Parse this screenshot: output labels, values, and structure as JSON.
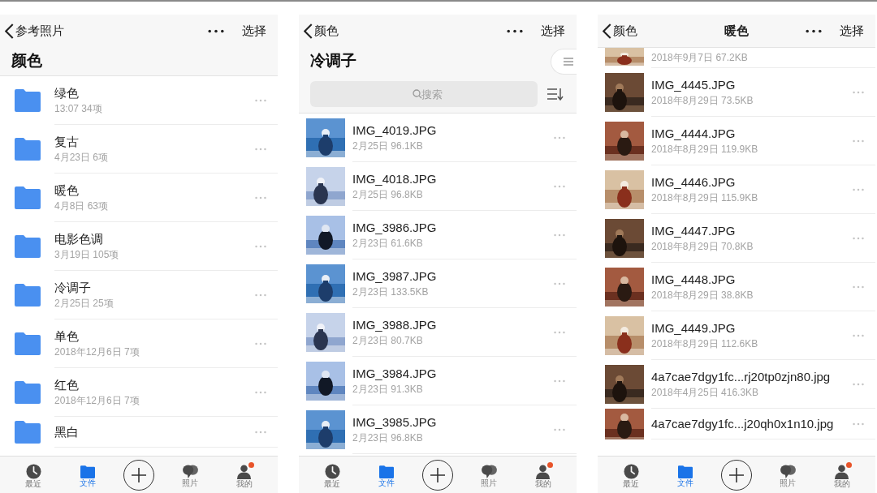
{
  "screens": [
    {
      "nav": {
        "back": "参考照片",
        "action": "选择"
      },
      "heading": "颜色",
      "items": [
        {
          "kind": "folder",
          "name": "绿色",
          "subtitle": "13:07  34项"
        },
        {
          "kind": "folder",
          "name": "复古",
          "subtitle": "4月23日  6项"
        },
        {
          "kind": "folder",
          "name": "暖色",
          "subtitle": "4月8日  63项"
        },
        {
          "kind": "folder",
          "name": "电影色调",
          "subtitle": "3月19日  105项"
        },
        {
          "kind": "folder",
          "name": "冷调子",
          "subtitle": "2月25日  25项"
        },
        {
          "kind": "folder",
          "name": "单色",
          "subtitle": "2018年12月6日  7项"
        },
        {
          "kind": "folder",
          "name": "红色",
          "subtitle": "2018年12月6日  7项"
        },
        {
          "kind": "folder",
          "name": "黑白"
        }
      ],
      "tabs": [
        {
          "kind": "clock",
          "label": "最近",
          "selected": false
        },
        {
          "kind": "folder",
          "label": "文件",
          "selected": true
        },
        {
          "kind": "add"
        },
        {
          "kind": "photos",
          "label": "照片",
          "selected": false
        },
        {
          "kind": "person",
          "label": "我的",
          "selected": false,
          "badge": true
        }
      ]
    },
    {
      "nav": {
        "back": "颜色",
        "action": "选择"
      },
      "heading": "冷调子",
      "view_toggle": true,
      "search": {
        "placeholder": "搜索"
      },
      "items": [
        {
          "name": "IMG_4019.JPG",
          "subtitle": "2月25日 96.1KB"
        },
        {
          "name": "IMG_4018.JPG",
          "subtitle": "2月25日 96.8KB"
        },
        {
          "name": "IMG_3986.JPG",
          "subtitle": "2月23日 61.6KB"
        },
        {
          "name": "IMG_3987.JPG",
          "subtitle": "2月23日 133.5KB"
        },
        {
          "name": "IMG_3988.JPG",
          "subtitle": "2月23日 80.7KB"
        },
        {
          "name": "IMG_3984.JPG",
          "subtitle": "2月23日 91.3KB"
        },
        {
          "name": "IMG_3985.JPG",
          "subtitle": "2月23日 96.8KB"
        }
      ],
      "tabs": [
        {
          "kind": "clock",
          "label": "最近",
          "selected": false
        },
        {
          "kind": "folder",
          "label": "文件",
          "selected": true
        },
        {
          "kind": "add"
        },
        {
          "kind": "photos",
          "label": "照片",
          "selected": false
        },
        {
          "kind": "person",
          "label": "我的",
          "selected": false,
          "badge": true
        }
      ]
    },
    {
      "nav": {
        "back": "颜色",
        "title": "暖色",
        "action": "选择"
      },
      "items": [
        {
          "subtitle": "2018年9月7日 67.2KB"
        },
        {
          "name": "IMG_4445.JPG",
          "subtitle": "2018年8月29日 73.5KB"
        },
        {
          "name": "IMG_4444.JPG",
          "subtitle": "2018年8月29日 119.9KB"
        },
        {
          "name": "IMG_4446.JPG",
          "subtitle": "2018年8月29日 115.9KB"
        },
        {
          "name": "IMG_4447.JPG",
          "subtitle": "2018年8月29日 70.8KB"
        },
        {
          "name": "IMG_4448.JPG",
          "subtitle": "2018年8月29日 38.8KB"
        },
        {
          "name": "IMG_4449.JPG",
          "subtitle": "2018年8月29日 112.6KB"
        },
        {
          "name": "4a7cae7dgy1fc...rj20tp0zjn80.jpg",
          "subtitle": "2018年4月25日 416.3KB"
        },
        {
          "name": "4a7cae7dgy1fc...j20qh0x1n10.jpg"
        }
      ],
      "tabs": [
        {
          "kind": "clock",
          "label": "最近",
          "selected": false
        },
        {
          "kind": "folder",
          "label": "文件",
          "selected": true
        },
        {
          "kind": "add"
        },
        {
          "kind": "photos",
          "label": "照片",
          "selected": false
        },
        {
          "kind": "person",
          "label": "我的",
          "selected": false,
          "badge": true
        }
      ]
    }
  ]
}
